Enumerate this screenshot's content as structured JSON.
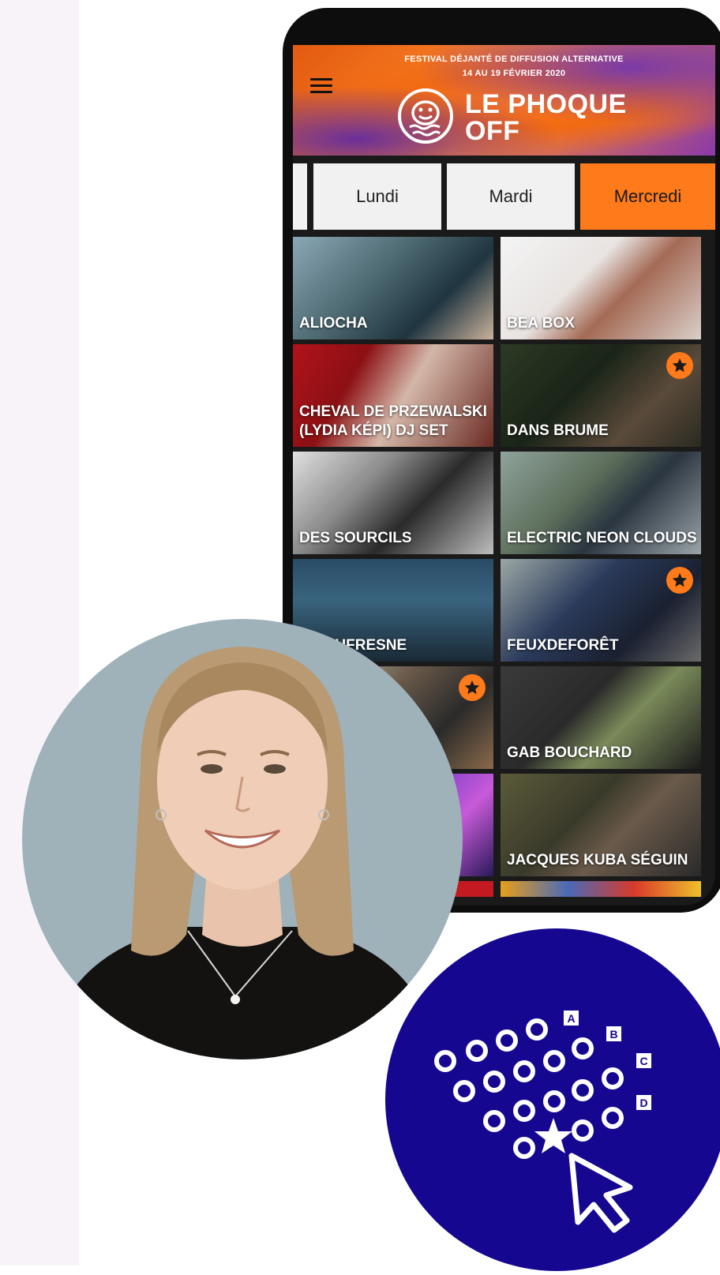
{
  "banner": {
    "line1": "FESTIVAL DÉJANTÉ DE DIFFUSION ALTERNATIVE",
    "line2": "14 AU 19 FÉVRIER 2020",
    "title_line1": "LE PHOQUE",
    "title_line2": "OFF"
  },
  "tabs": [
    {
      "label": "Lundi"
    },
    {
      "label": "Mardi"
    },
    {
      "label": "Mercredi",
      "active": true
    }
  ],
  "artists": [
    {
      "name": "ALIOCHA",
      "favorite": false
    },
    {
      "name": "BEA BOX",
      "favorite": false
    },
    {
      "name": "CHEVAL DE PRZEWALSKI",
      "name2": "(LYDIA KÉPI) DJ SET",
      "favorite": false
    },
    {
      "name": "DANS BRUME",
      "favorite": true
    },
    {
      "name": "DES SOURCILS",
      "favorite": false
    },
    {
      "name": "ELECTRIC NEON CLOUDS",
      "favorite": false
    },
    {
      "name": "NE DUFRESNE",
      "favorite": false
    },
    {
      "name": "FEUXDEFORÊT",
      "favorite": true
    },
    {
      "name": "",
      "favorite": true
    },
    {
      "name": "GAB BOUCHARD",
      "favorite": false
    },
    {
      "name": "",
      "favorite": false
    },
    {
      "name": "JACQUES KUBA SÉGUIN",
      "favorite": false
    }
  ],
  "seat_labels": [
    "A",
    "B",
    "C",
    "D"
  ],
  "colors": {
    "accent": "#ff7a1a",
    "seat_badge_bg": "#150790",
    "sidebar": "#f7f3f9"
  },
  "icons": [
    "menu-icon",
    "seal-logo-icon",
    "star-icon",
    "cursor-icon",
    "seat-icon"
  ]
}
